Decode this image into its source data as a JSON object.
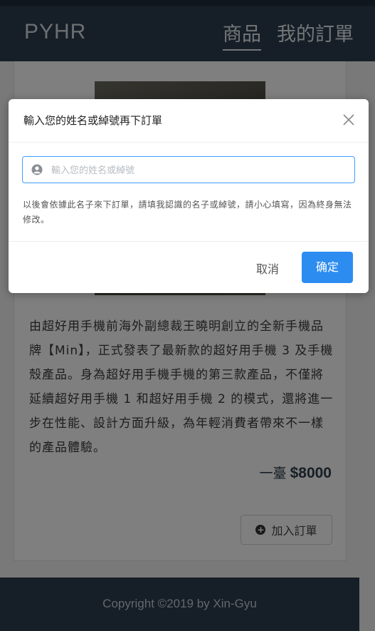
{
  "header": {
    "brand": "PYHR",
    "nav": [
      {
        "label": "商品",
        "active": true
      },
      {
        "label": "我的訂單",
        "active": false
      }
    ]
  },
  "product": {
    "description": "由超好用手機前海外副總裁王曉明創立的全新手機品牌【Min】，正式發表了最新款的超好用手機 3 及手機殼產品。身為超好用手機手機的第三款產品，不僅將延續超好用手機 1 和超好用手機 2 的模式，還將進一步在性能、設計方面升級，為年輕消費者帶來不一樣的產品體驗。",
    "price_unit": "一臺",
    "price": "$8000",
    "add_label": "加入訂單"
  },
  "footer": {
    "copyright": "Copyright ©2019 by Xin-Gyu"
  },
  "dialog": {
    "title": "輸入您的姓名或綽號再下訂單",
    "input_placeholder": "輸入您的姓名或綽號",
    "input_value": "",
    "hint": "以後會依據此名子來下訂單，請填我認識的名子或綽號，請小心填寫，因為終身無法修改。",
    "cancel_label": "取消",
    "confirm_label": "确定"
  },
  "colors": {
    "header_bg": "#2c3e50",
    "primary": "#2d8cf0",
    "input_border": "#409eff"
  }
}
